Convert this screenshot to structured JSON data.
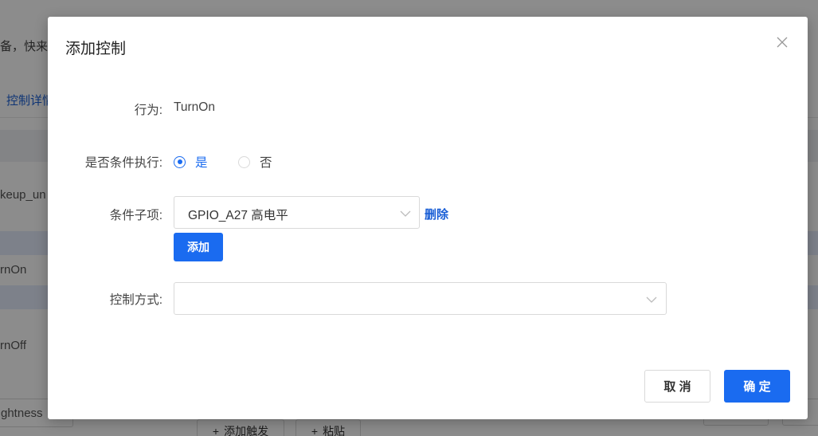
{
  "background": {
    "partial_text_1": "备，快来配",
    "tab_link": "控制详情",
    "row_texts": [
      "keup_un",
      "rnOn",
      "rnOff",
      "ghtness"
    ],
    "add_trigger_label": "添加触发",
    "paste_label": "粘贴"
  },
  "modal": {
    "title": "添加控制",
    "behavior_label": "行为:",
    "behavior_value": "TurnOn",
    "conditional_label": "是否条件执行:",
    "radio_yes": "是",
    "radio_no": "否",
    "radio_selected": "yes",
    "condition_item_label": "条件子项:",
    "condition_item_value": "GPIO_A27 高电平",
    "delete_label": "删除",
    "add_button": "添加",
    "control_mode_label": "控制方式:",
    "control_mode_value": "",
    "cancel_button": "取 消",
    "ok_button": "确 定"
  },
  "colors": {
    "primary": "#1a6bf0",
    "link": "#1a5fd6",
    "mask": "rgba(0,0,0,0.45)"
  },
  "icons": [
    "close-icon",
    "chevron-down-icon",
    "plus-icon"
  ]
}
